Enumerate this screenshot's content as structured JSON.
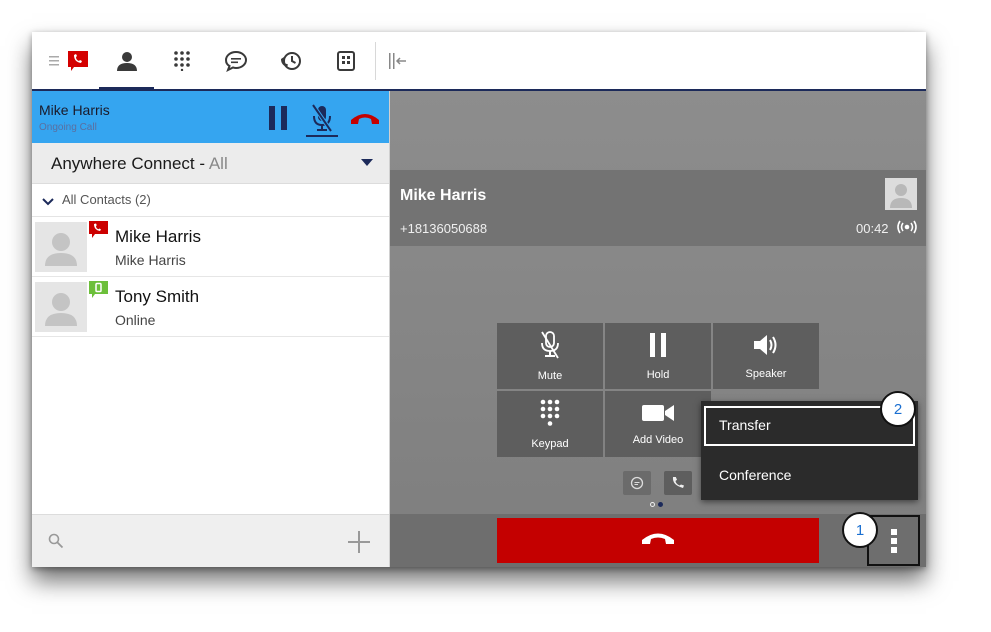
{
  "nav": {
    "items": [
      "menu-icon",
      "brand-phone-icon",
      "contacts-icon",
      "dialpad-icon",
      "chat-icon",
      "history-icon",
      "voicemail-icon",
      "collapse-panel-icon"
    ],
    "active": "contacts-icon",
    "accent": "#1c2a5a"
  },
  "call_bar": {
    "name": "Mike Harris",
    "status": "Ongoing Call",
    "background": "#35a5f0",
    "buttons": [
      "hold-icon",
      "mute-icon",
      "end-call-icon"
    ]
  },
  "anywhere": {
    "label": "Anywhere Connect -",
    "value": "All"
  },
  "contacts": {
    "group_label": "All Contacts (2)",
    "items": [
      {
        "name": "Mike Harris",
        "sub": "Mike Harris",
        "presence": "on-call",
        "presence_color": "#cc0000"
      },
      {
        "name": "Tony Smith",
        "sub": "Online",
        "presence": "online",
        "presence_color": "#6cbf3a"
      }
    ]
  },
  "call": {
    "name": "Mike Harris",
    "number": "+18136050688",
    "duration": "00:42",
    "controls": [
      {
        "label": "Mute",
        "icon": "mic-muted-icon"
      },
      {
        "label": "Hold",
        "icon": "pause-icon"
      },
      {
        "label": "Speaker",
        "icon": "speaker-icon"
      },
      {
        "label": "Keypad",
        "icon": "keypad-icon"
      },
      {
        "label": "Add Video",
        "icon": "video-camera-icon"
      }
    ],
    "page_indicator": {
      "pages": 2,
      "current": 2
    },
    "end_color": "#c40000"
  },
  "menu": {
    "items": [
      {
        "label": "Transfer"
      },
      {
        "label": "Conference"
      }
    ]
  },
  "markers": [
    "1",
    "2"
  ]
}
